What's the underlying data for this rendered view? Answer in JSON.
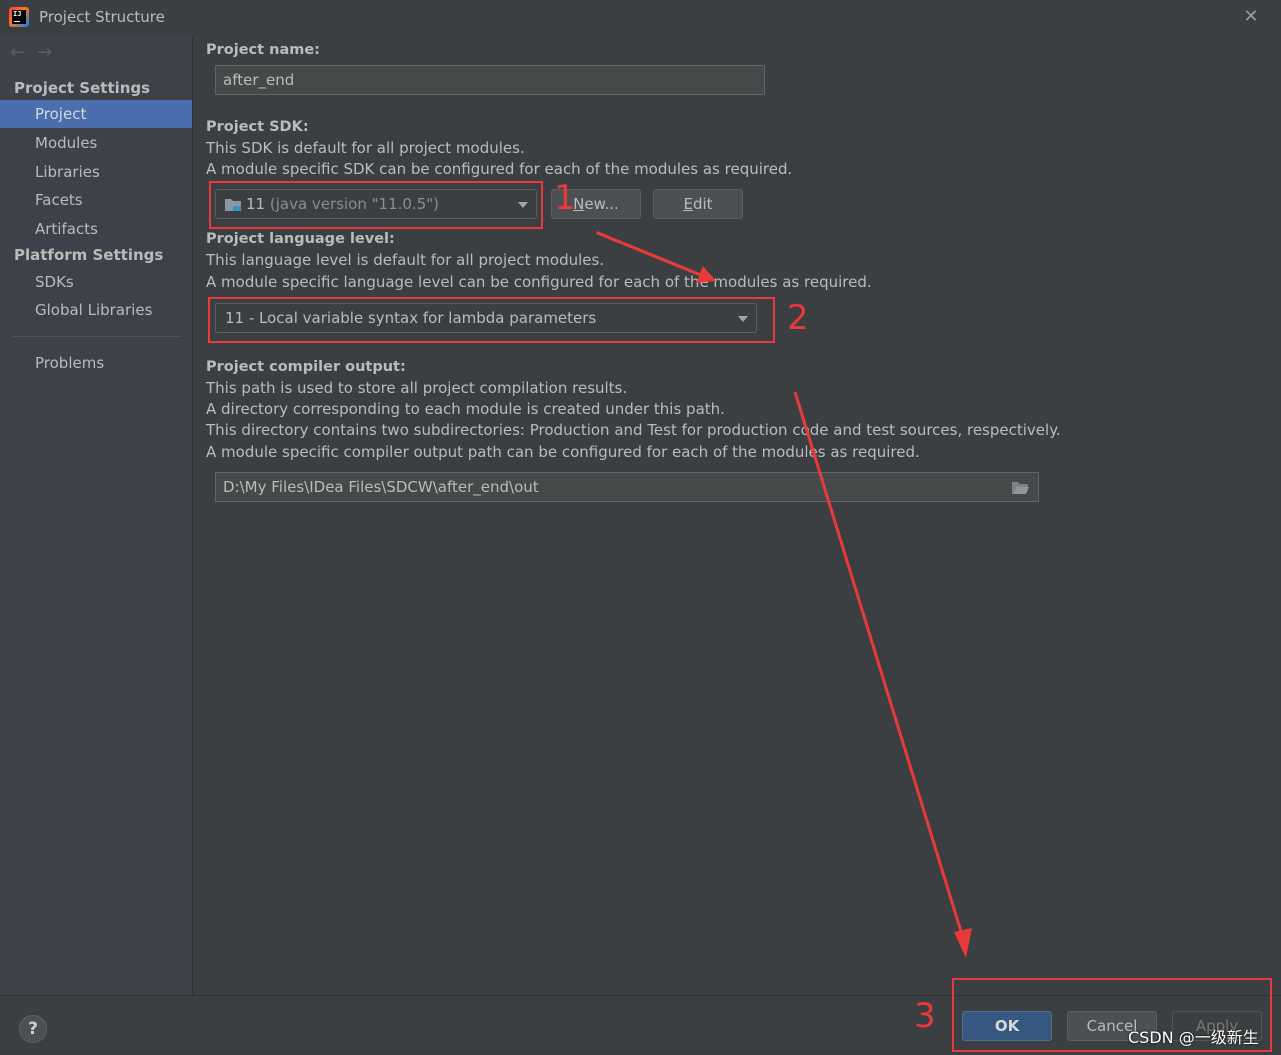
{
  "window": {
    "title": "Project Structure",
    "app_icon": "intellij-idea-icon",
    "close_icon": "close-icon"
  },
  "sidebar": {
    "back_icon": "←",
    "forward_icon": "→",
    "sections": [
      {
        "heading": "Project Settings",
        "items": [
          {
            "label": "Project",
            "selected": true
          },
          {
            "label": "Modules"
          },
          {
            "label": "Libraries"
          },
          {
            "label": "Facets"
          },
          {
            "label": "Artifacts"
          }
        ]
      },
      {
        "heading": "Platform Settings",
        "items": [
          {
            "label": "SDKs"
          },
          {
            "label": "Global Libraries"
          }
        ]
      }
    ],
    "problems_label": "Problems"
  },
  "main": {
    "project_name": {
      "label": "Project name:",
      "value": "after_end"
    },
    "project_sdk": {
      "label": "Project SDK:",
      "desc": [
        "This SDK is default for all project modules.",
        "A module specific SDK can be configured for each of the modules as required."
      ],
      "selected_version": "11",
      "selected_detail": "(java version \"11.0.5\")",
      "new_button": "New...",
      "edit_button": "Edit"
    },
    "language_level": {
      "label": "Project language level:",
      "desc": [
        "This language level is default for all project modules.",
        "A module specific language level can be configured for each of the modules as required."
      ],
      "selected": "11 - Local variable syntax for lambda parameters"
    },
    "compiler_output": {
      "label": "Project compiler output:",
      "desc": [
        "This path is used to store all project compilation results.",
        "A directory corresponding to each module is created under this path.",
        "This directory contains two subdirectories: Production and Test for production code and test sources, respectively.",
        "A module specific compiler output path can be configured for each of the modules as required."
      ],
      "path": "D:\\My Files\\IDea Files\\SDCW\\after_end\\out"
    }
  },
  "footer": {
    "help_label": "?",
    "ok_label": "OK",
    "cancel_label": "Cancel",
    "apply_label": "Apply"
  },
  "annotations": {
    "step1": "1",
    "step2": "2",
    "step3": "3",
    "color": "#e83a3a"
  },
  "watermark": "CSDN @一级新生",
  "colors": {
    "background": "#3c3f41",
    "sidebar": "#3e4149",
    "selection": "#4b6eaf",
    "ok_button": "#365880"
  }
}
